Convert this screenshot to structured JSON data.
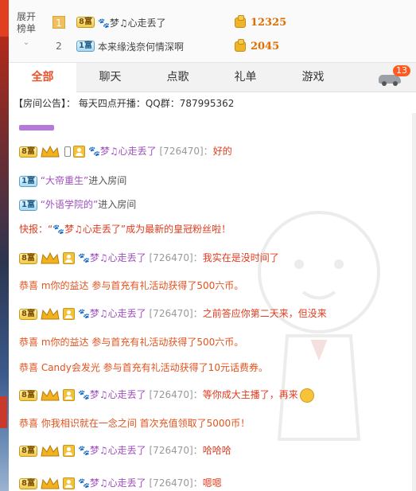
{
  "rank": {
    "expand_line1": "展开",
    "expand_line2": "榜单",
    "entries": [
      {
        "rank": "1",
        "level": "8富",
        "name": "🐾梦♫心走丢了",
        "score": "12325"
      },
      {
        "rank": "2",
        "level": "1富",
        "name": "本来缘浅奈何情深啊",
        "score": "2045"
      }
    ]
  },
  "tabs": [
    {
      "label": "全部",
      "active": true
    },
    {
      "label": "聊天"
    },
    {
      "label": "点歌"
    },
    {
      "label": "礼单"
    },
    {
      "label": "游戏"
    }
  ],
  "car_badge": "13",
  "announcement": "【房间公告】： 每天四点开播：QQ群：787995362",
  "messages": {
    "m1": {
      "level": "8富",
      "name": "🐾梦♫心走丢了",
      "uid": "[726470]",
      "sep": "：",
      "text": "好的"
    },
    "m2": {
      "level": "1富",
      "quoted": "“大帝重生”",
      "text": "进入房间"
    },
    "m3": {
      "level": "1富",
      "quoted": "“外语学院的”",
      "text": "进入房间"
    },
    "m4": {
      "text": "快报：“🐾梦♫心走丢了”成为最新的皇冠粉丝啦！"
    },
    "m5": {
      "level": "8富",
      "name": "🐾梦♫心走丢了",
      "uid": "[726470]",
      "sep": "：",
      "text": "我实在是没时间了"
    },
    "m6": {
      "text": "恭喜 m你的益达 参与首充有礼活动获得了500六币。"
    },
    "m7": {
      "level": "8富",
      "name": "🐾梦♫心走丢了",
      "uid": "[726470]",
      "sep": "：",
      "text": "之前答应你第二天来，但没来"
    },
    "m8": {
      "text": "恭喜 m你的益达 参与首充有礼活动获得了500六币。"
    },
    "m9": {
      "text": "恭喜 Candy会发光 参与首充有礼活动获得了10元话费券。"
    },
    "m10": {
      "level": "8富",
      "name": "🐾梦♫心走丢了",
      "uid": "[726470]",
      "sep": "：",
      "text": "等你成大主播了，再来"
    },
    "m11": {
      "text": "恭喜 你我相识就在一念之间 首次充值领取了5000币！"
    },
    "m12": {
      "level": "8富",
      "name": "🐾梦♫心走丢了",
      "uid": "[726470]",
      "sep": "：",
      "text": "哈哈哈"
    },
    "m13": {
      "level": "8富",
      "name": "🐾梦♫心走丢了",
      "uid": "[726470]",
      "sep": "：",
      "text": "嗯嗯"
    }
  }
}
